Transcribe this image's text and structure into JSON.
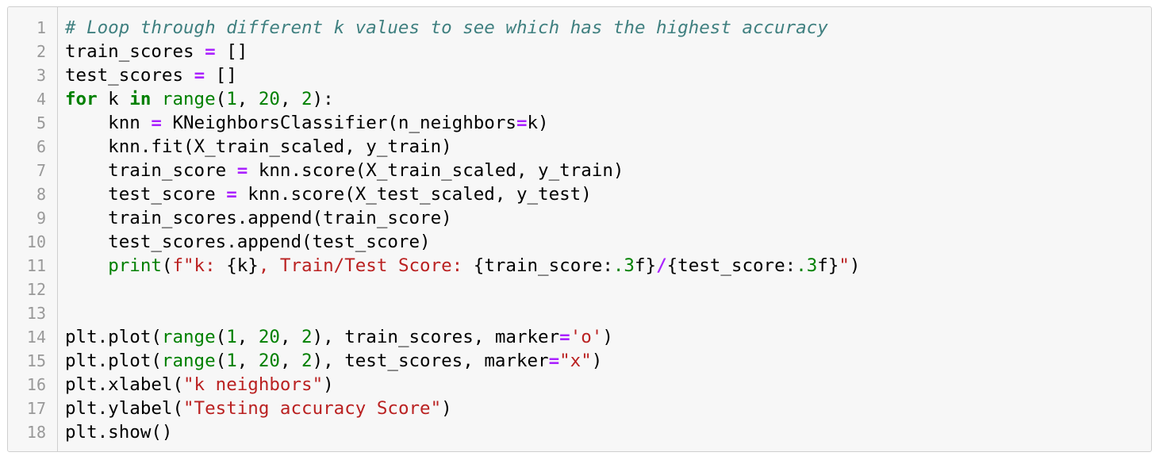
{
  "editor": {
    "lines": [
      {
        "n": "1",
        "tokens": [
          {
            "t": "# Loop through different k values to see which has the highest accuracy",
            "c": "comment"
          }
        ]
      },
      {
        "n": "2",
        "tokens": [
          {
            "t": "train_scores ",
            "c": "plain"
          },
          {
            "t": "=",
            "c": "op"
          },
          {
            "t": " []",
            "c": "plain"
          }
        ]
      },
      {
        "n": "3",
        "tokens": [
          {
            "t": "test_scores ",
            "c": "plain"
          },
          {
            "t": "=",
            "c": "op"
          },
          {
            "t": " []",
            "c": "plain"
          }
        ]
      },
      {
        "n": "4",
        "tokens": [
          {
            "t": "for",
            "c": "kw"
          },
          {
            "t": " k ",
            "c": "plain"
          },
          {
            "t": "in",
            "c": "kw"
          },
          {
            "t": " ",
            "c": "plain"
          },
          {
            "t": "range",
            "c": "builtin"
          },
          {
            "t": "(",
            "c": "plain"
          },
          {
            "t": "1",
            "c": "num"
          },
          {
            "t": ", ",
            "c": "plain"
          },
          {
            "t": "20",
            "c": "num"
          },
          {
            "t": ", ",
            "c": "plain"
          },
          {
            "t": "2",
            "c": "num"
          },
          {
            "t": "):",
            "c": "plain"
          }
        ]
      },
      {
        "n": "5",
        "tokens": [
          {
            "t": "    knn ",
            "c": "plain"
          },
          {
            "t": "=",
            "c": "op"
          },
          {
            "t": " KNeighborsClassifier(n_neighbors",
            "c": "plain"
          },
          {
            "t": "=",
            "c": "op"
          },
          {
            "t": "k)",
            "c": "plain"
          }
        ]
      },
      {
        "n": "6",
        "tokens": [
          {
            "t": "    knn.fit(X_train_scaled, y_train)",
            "c": "plain"
          }
        ]
      },
      {
        "n": "7",
        "tokens": [
          {
            "t": "    train_score ",
            "c": "plain"
          },
          {
            "t": "=",
            "c": "op"
          },
          {
            "t": " knn.score(X_train_scaled, y_train)",
            "c": "plain"
          }
        ]
      },
      {
        "n": "8",
        "tokens": [
          {
            "t": "    test_score ",
            "c": "plain"
          },
          {
            "t": "=",
            "c": "op"
          },
          {
            "t": " knn.score(X_test_scaled, y_test)",
            "c": "plain"
          }
        ]
      },
      {
        "n": "9",
        "tokens": [
          {
            "t": "    train_scores.append(train_score)",
            "c": "plain"
          }
        ]
      },
      {
        "n": "10",
        "tokens": [
          {
            "t": "    test_scores.append(test_score)",
            "c": "plain"
          }
        ]
      },
      {
        "n": "11",
        "tokens": [
          {
            "t": "    ",
            "c": "plain"
          },
          {
            "t": "print",
            "c": "builtin"
          },
          {
            "t": "(",
            "c": "plain"
          },
          {
            "t": "f\"k: ",
            "c": "str"
          },
          {
            "t": "{k}",
            "c": "brace"
          },
          {
            "t": ", Train/Test Score: ",
            "c": "str"
          },
          {
            "t": "{train_score:",
            "c": "brace"
          },
          {
            "t": ".3",
            "c": "num"
          },
          {
            "t": "f}",
            "c": "brace"
          },
          {
            "t": "/",
            "c": "op"
          },
          {
            "t": "{test_score:",
            "c": "brace"
          },
          {
            "t": ".3",
            "c": "num"
          },
          {
            "t": "f}",
            "c": "brace"
          },
          {
            "t": "\"",
            "c": "str"
          },
          {
            "t": ")",
            "c": "plain"
          }
        ]
      },
      {
        "n": "12",
        "tokens": []
      },
      {
        "n": "13",
        "tokens": []
      },
      {
        "n": "14",
        "tokens": [
          {
            "t": "plt.plot(",
            "c": "plain"
          },
          {
            "t": "range",
            "c": "builtin"
          },
          {
            "t": "(",
            "c": "plain"
          },
          {
            "t": "1",
            "c": "num"
          },
          {
            "t": ", ",
            "c": "plain"
          },
          {
            "t": "20",
            "c": "num"
          },
          {
            "t": ", ",
            "c": "plain"
          },
          {
            "t": "2",
            "c": "num"
          },
          {
            "t": "), train_scores, marker",
            "c": "plain"
          },
          {
            "t": "=",
            "c": "op"
          },
          {
            "t": "'o'",
            "c": "str"
          },
          {
            "t": ")",
            "c": "plain"
          }
        ]
      },
      {
        "n": "15",
        "tokens": [
          {
            "t": "plt.plot(",
            "c": "plain"
          },
          {
            "t": "range",
            "c": "builtin"
          },
          {
            "t": "(",
            "c": "plain"
          },
          {
            "t": "1",
            "c": "num"
          },
          {
            "t": ", ",
            "c": "plain"
          },
          {
            "t": "20",
            "c": "num"
          },
          {
            "t": ", ",
            "c": "plain"
          },
          {
            "t": "2",
            "c": "num"
          },
          {
            "t": "), test_scores, marker",
            "c": "plain"
          },
          {
            "t": "=",
            "c": "op"
          },
          {
            "t": "\"x\"",
            "c": "str"
          },
          {
            "t": ")",
            "c": "plain"
          }
        ]
      },
      {
        "n": "16",
        "tokens": [
          {
            "t": "plt.xlabel(",
            "c": "plain"
          },
          {
            "t": "\"k neighbors\"",
            "c": "str"
          },
          {
            "t": ")",
            "c": "plain"
          }
        ]
      },
      {
        "n": "17",
        "tokens": [
          {
            "t": "plt.ylabel(",
            "c": "plain"
          },
          {
            "t": "\"Testing accuracy Score\"",
            "c": "str"
          },
          {
            "t": ")",
            "c": "plain"
          }
        ]
      },
      {
        "n": "18",
        "tokens": [
          {
            "t": "plt.show()",
            "c": "plain"
          }
        ]
      }
    ]
  }
}
